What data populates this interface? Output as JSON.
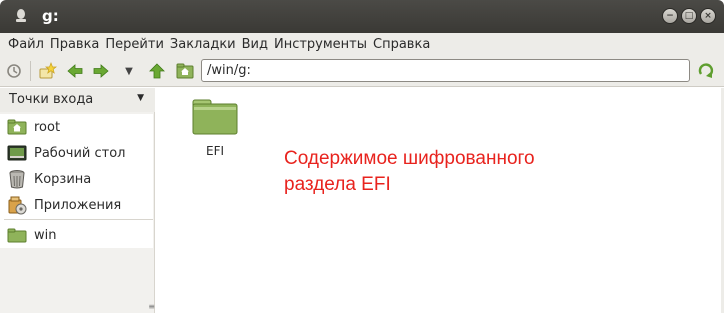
{
  "window": {
    "title": "g:",
    "buttons": [
      "−",
      "□",
      "×"
    ]
  },
  "menubar": {
    "items": [
      "Файл",
      "Правка",
      "Перейти",
      "Закладки",
      "Вид",
      "Инструменты",
      "Справка"
    ]
  },
  "toolbar": {
    "address_value": "/win/g:",
    "icons": [
      "history-icon",
      "new-tab-star-icon",
      "back-icon",
      "forward-icon",
      "dropdown-icon",
      "up-icon",
      "home-icon",
      "go-icon"
    ]
  },
  "sidebar": {
    "header": "Точки входа",
    "items": [
      {
        "label": "root",
        "icon": "home-folder-icon"
      },
      {
        "label": "Рабочий стол",
        "icon": "desktop-icon"
      },
      {
        "label": "Корзина",
        "icon": "trash-icon"
      },
      {
        "label": "Приложения",
        "icon": "applications-icon"
      }
    ],
    "mounts": [
      {
        "label": "win",
        "icon": "folder-icon"
      }
    ]
  },
  "main": {
    "files": [
      {
        "name": "EFI",
        "icon": "folder-icon"
      }
    ],
    "annotation_line1": "Содержимое шифрованного",
    "annotation_line2": "раздела EFI"
  },
  "colors": {
    "titlebar": "#3f3e3a",
    "chrome": "#edece8",
    "folder_green": "#8fb35a",
    "annotation": "#e8231e",
    "arrow_green": "#5f9e2f"
  }
}
